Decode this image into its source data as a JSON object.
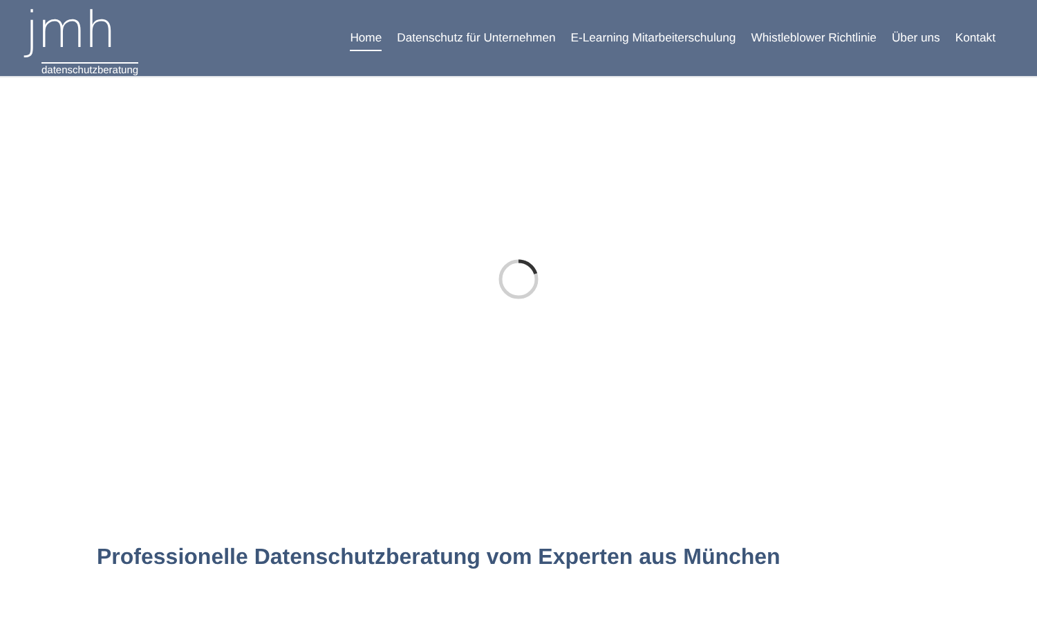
{
  "logo": {
    "mark": "jmh",
    "tagline": "datenschutzberatung"
  },
  "nav": [
    {
      "label": "Home",
      "selected": true
    },
    {
      "label": "Datenschutz für Unternehmen",
      "selected": false
    },
    {
      "label": "E-Learning Mitarbeiterschulung",
      "selected": false
    },
    {
      "label": "Whistleblower Richtlinie",
      "selected": false
    },
    {
      "label": "Über uns",
      "selected": false
    },
    {
      "label": "Kontakt",
      "selected": false
    }
  ],
  "heading": "Professionelle Datenschutzberatung vom Experten aus München"
}
